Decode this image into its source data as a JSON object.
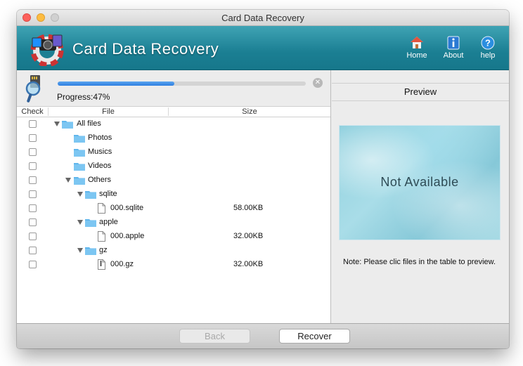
{
  "window": {
    "title": "Card Data Recovery"
  },
  "header": {
    "app_name": "Card Data Recovery",
    "nav": [
      {
        "label": "Home",
        "icon": "home-icon"
      },
      {
        "label": "About",
        "icon": "info-icon"
      },
      {
        "label": "help",
        "icon": "help-icon"
      }
    ]
  },
  "progress": {
    "text": "Progress:47%",
    "fraction": 0.47
  },
  "table": {
    "columns": {
      "check": "Check",
      "file": "File",
      "size": "Size"
    },
    "rows": [
      {
        "name": "All files",
        "kind": "folder",
        "size": "",
        "expandable": true
      },
      {
        "name": "Photos",
        "kind": "folder",
        "size": "",
        "expandable": false
      },
      {
        "name": "Musics",
        "kind": "folder",
        "size": "",
        "expandable": false
      },
      {
        "name": "Videos",
        "kind": "folder",
        "size": "",
        "expandable": false
      },
      {
        "name": "Others",
        "kind": "folder",
        "size": "",
        "expandable": true
      },
      {
        "name": "sqlite",
        "kind": "folder",
        "size": "",
        "expandable": true
      },
      {
        "name": "000.sqlite",
        "kind": "file",
        "size": "58.00KB",
        "expandable": false
      },
      {
        "name": "apple",
        "kind": "folder",
        "size": "",
        "expandable": true
      },
      {
        "name": "000.apple",
        "kind": "file",
        "size": "32.00KB",
        "expandable": false
      },
      {
        "name": "gz",
        "kind": "folder",
        "size": "",
        "expandable": true
      },
      {
        "name": "000.gz",
        "kind": "file",
        "size": "32.00KB",
        "expandable": false
      }
    ]
  },
  "preview": {
    "title": "Preview",
    "placeholder": "Not Available",
    "note": "Note: Please clic files in the table to preview."
  },
  "buttons": {
    "back": "Back",
    "recover": "Recover"
  },
  "colors": {
    "header": "#1b7f93",
    "progress": "#2d7ee0",
    "folder": "#5fb6ec"
  }
}
